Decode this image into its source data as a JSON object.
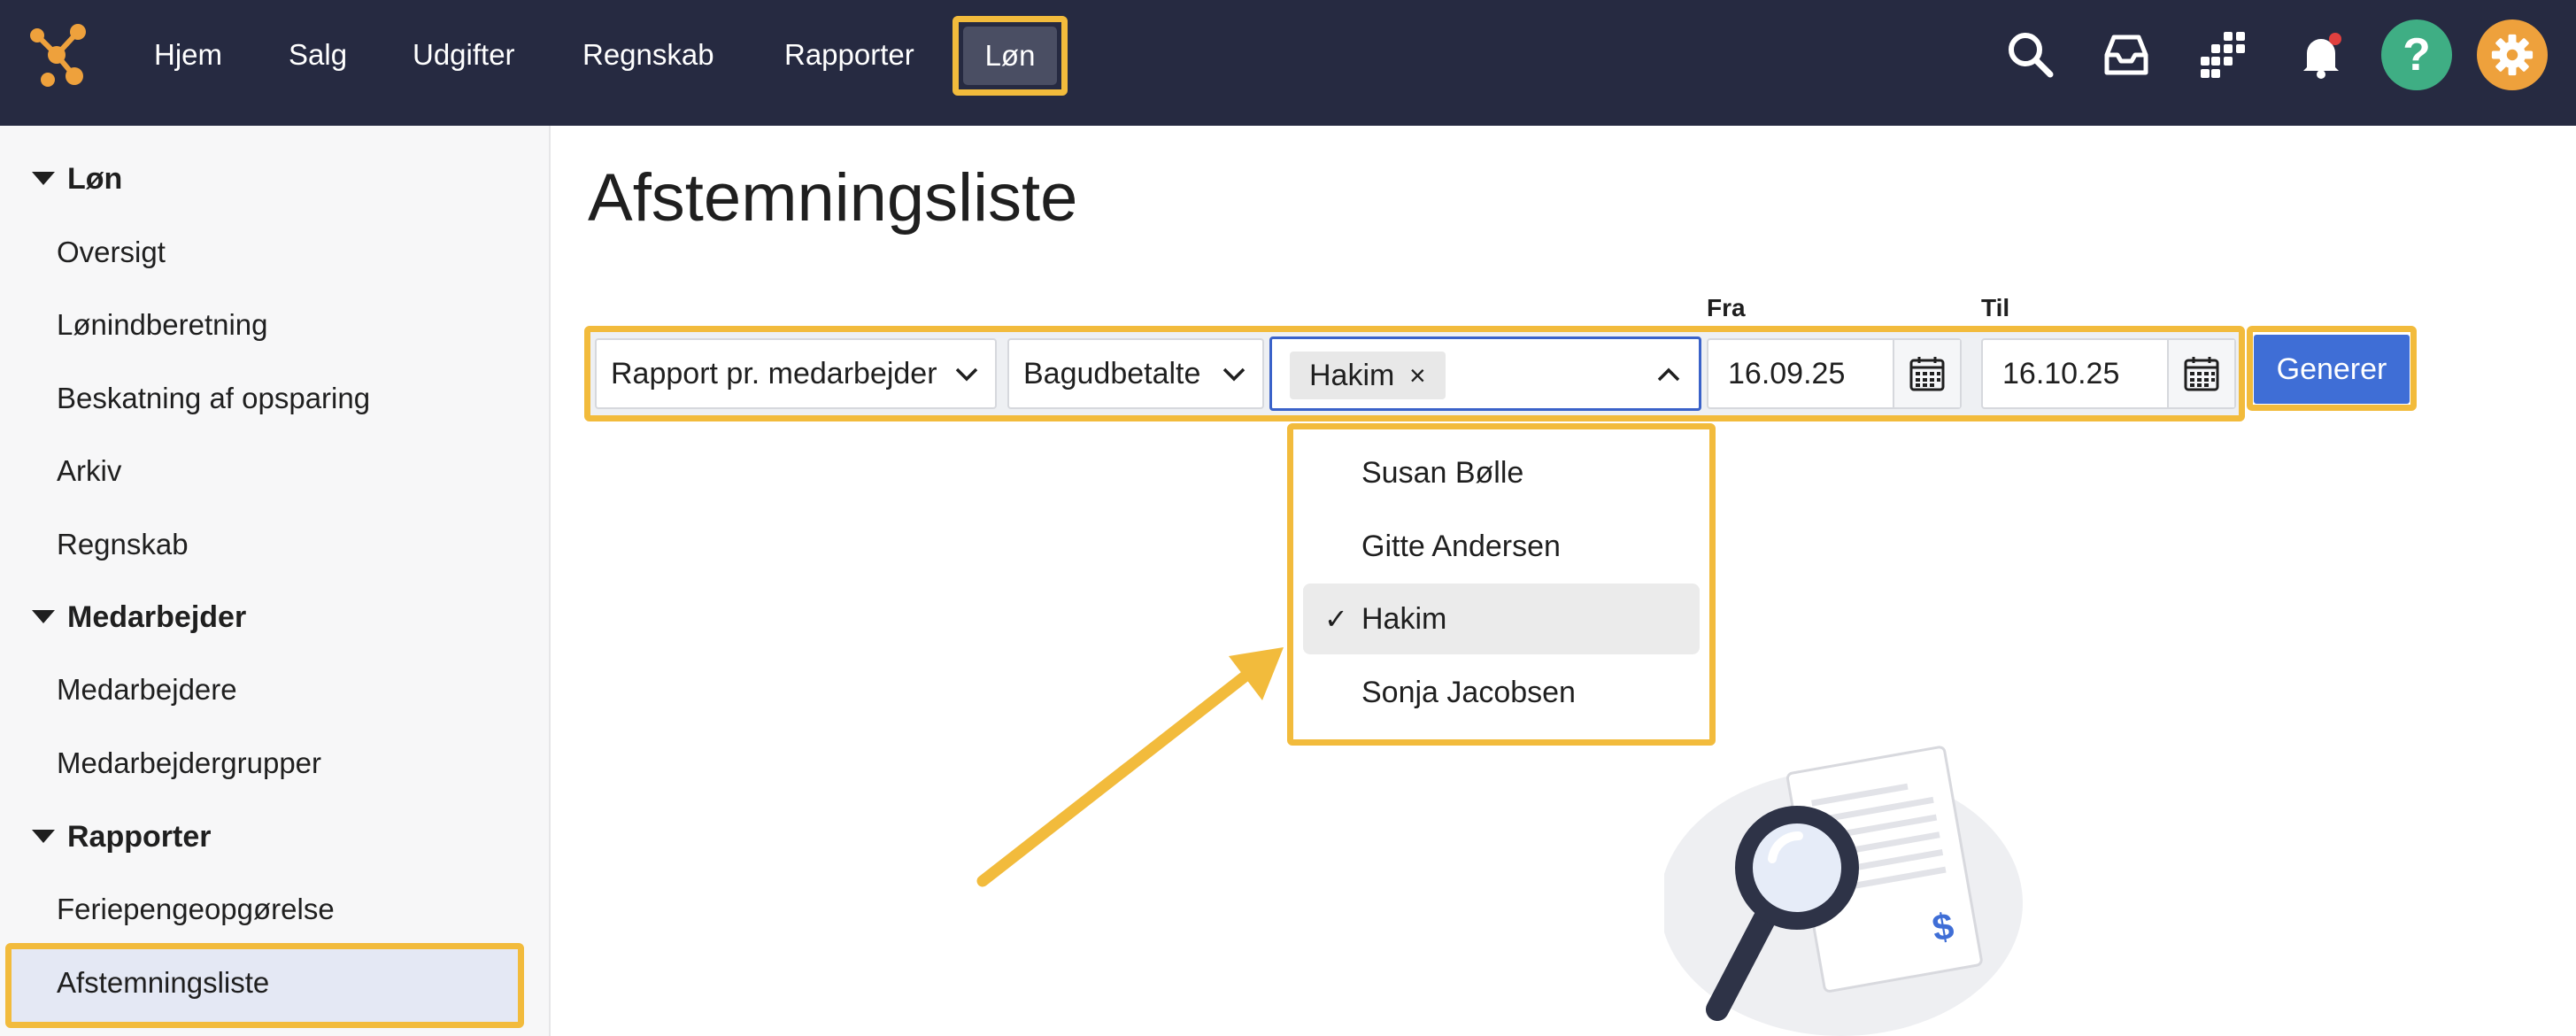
{
  "topbar": {
    "nav": [
      "Hjem",
      "Salg",
      "Udgifter",
      "Regnskab",
      "Rapporter"
    ],
    "active_nav": "Løn",
    "icons": [
      "search-icon",
      "inbox-icon",
      "apps-grid-icon",
      "notification-bell-icon",
      "help-icon",
      "settings-gear-icon"
    ],
    "colors": {
      "bar": "#262a41",
      "help": "#3fae84",
      "settings": "#eea13c",
      "highlight": "#f2bb3c"
    }
  },
  "sidebar": {
    "sections": [
      {
        "title": "Løn",
        "items": [
          "Oversigt",
          "Lønindberetning",
          "Beskatning af opsparing",
          "Arkiv",
          "Regnskab"
        ]
      },
      {
        "title": "Medarbejder",
        "items": [
          "Medarbejdere",
          "Medarbejdergrupper"
        ]
      },
      {
        "title": "Rapporter",
        "items": [
          "Feriepengeopgørelse",
          "Afstemningsliste"
        ]
      }
    ],
    "active_item": "Afstemningsliste"
  },
  "main": {
    "title": "Afstemningsliste",
    "report_type": "Rapport pr. medarbejder",
    "payment_type": "Bagudbetalte",
    "selected_employee": "Hakim",
    "chip_remove": "×",
    "from_label": "Fra",
    "from_value": "16.09.25",
    "to_label": "Til",
    "to_value": "16.10.25",
    "generate_label": "Generer"
  },
  "dropdown": {
    "options": [
      "Susan Bølle",
      "Gitte Andersen",
      "Hakim",
      "Sonja Jacobsen"
    ],
    "selected": "Hakim",
    "check": "✓"
  }
}
